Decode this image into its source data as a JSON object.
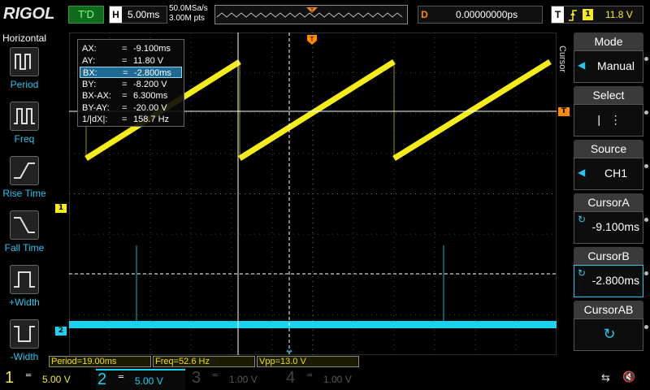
{
  "topbar": {
    "brand": "RIGOL",
    "trigger_state": "T'D",
    "horizontal_key": "H",
    "timebase": "5.00ms",
    "sample_rate": "50.0MSa/s",
    "memory_depth": "3.00M pts",
    "delay_key": "D",
    "delay": "0.00000000ps",
    "trigger_key": "T",
    "trigger_source": "1",
    "trigger_level": "11.8 V"
  },
  "left_menu": {
    "title": "Horizontal",
    "items": [
      {
        "label": "Period",
        "icon": "period-icon"
      },
      {
        "label": "Freq",
        "icon": "frequency-icon"
      },
      {
        "label": "Rise Time",
        "icon": "rise-time-icon"
      },
      {
        "label": "Fall Time",
        "icon": "fall-time-icon"
      },
      {
        "label": "+Width",
        "icon": "positive-width-icon"
      },
      {
        "label": "-Width",
        "icon": "negative-width-icon"
      }
    ]
  },
  "readout": {
    "rows": [
      {
        "k": "AX:",
        "v": "-9.100ms"
      },
      {
        "k": "AY:",
        "v": "11.80 V"
      },
      {
        "k": "BX:",
        "v": "-2.800ms"
      },
      {
        "k": "BY:",
        "v": "-8.200 V"
      },
      {
        "k": "BX-AX:",
        "v": "6.300ms"
      },
      {
        "k": "BY-AY:",
        "v": "-20.00 V"
      },
      {
        "k": "1/|dX|:",
        "v": "158.7 Hz"
      }
    ],
    "eq": "="
  },
  "markers": {
    "ch1": "1",
    "ch2": "2",
    "trigger_level": "T"
  },
  "measurements": {
    "period": "Period=19.00ms",
    "freq": "Freq=52.6 Hz",
    "vpp": "Vpp=13.0 V"
  },
  "channels": [
    {
      "num": "1",
      "scale": "5.00 V",
      "color": "#f5ec1a",
      "active": true
    },
    {
      "num": "2",
      "scale": "5.00 V",
      "color": "#19d3f0",
      "active": true
    },
    {
      "num": "3",
      "scale": "1.00 V",
      "color": "#b300b3",
      "active": false
    },
    {
      "num": "4",
      "scale": "1.00 V",
      "color": "#1a5fd6",
      "active": false
    }
  ],
  "right_menu": {
    "tab": "Cursor",
    "items": [
      {
        "head": "Mode",
        "value": "Manual"
      },
      {
        "head": "Select",
        "value": ""
      },
      {
        "head": "Source",
        "value": "CH1"
      },
      {
        "head": "CursorA",
        "value": "-9.100ms"
      },
      {
        "head": "CursorB",
        "value": "-2.800ms"
      },
      {
        "head": "CursorAB",
        "value": ""
      }
    ]
  },
  "colors": {
    "ch1": "#f5ec1a",
    "ch2": "#19d3f0",
    "trigger": "#ff8a00",
    "accent": "#27c6ee"
  }
}
